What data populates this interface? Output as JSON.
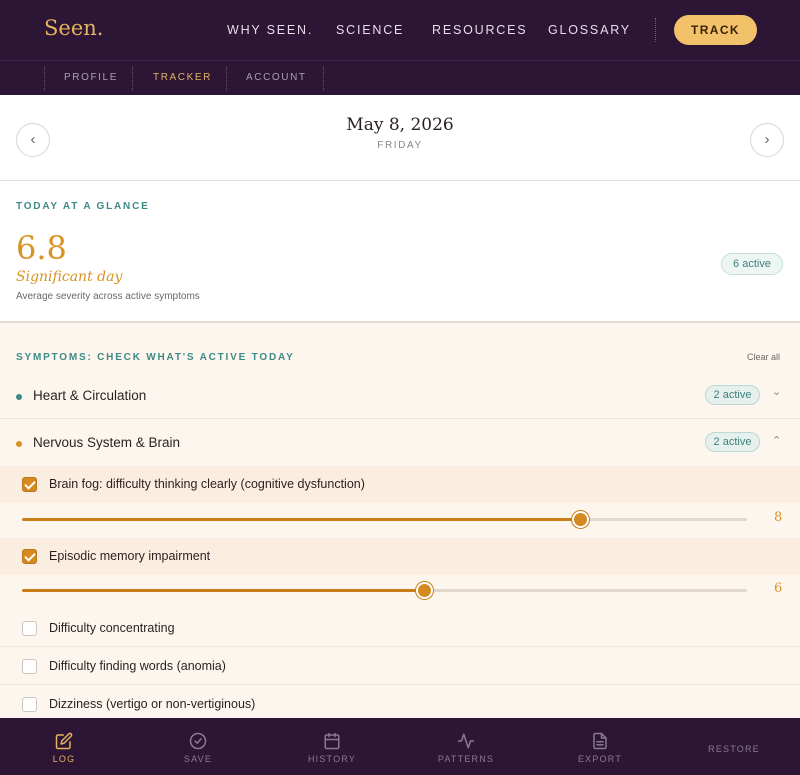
{
  "brand": {
    "logo": "Seen."
  },
  "nav": {
    "items": [
      {
        "label": "WHY SEEN."
      },
      {
        "label": "SCIENCE"
      },
      {
        "label": "RESOURCES"
      },
      {
        "label": "GLOSSARY"
      }
    ],
    "cta_label": "TRACK"
  },
  "subnav": {
    "items": [
      {
        "label": "PROFILE"
      },
      {
        "label": "TRACKER",
        "active": true
      },
      {
        "label": "ACCOUNT"
      }
    ]
  },
  "date": {
    "main": "May 8, 2026",
    "day": "FRIDAY",
    "prev_icon": "chevron-left-icon",
    "next_icon": "chevron-right-icon"
  },
  "glance": {
    "label": "TODAY AT A GLANCE",
    "score": "6.8",
    "score_word": "Significant day",
    "description": "Average severity across active symptoms",
    "active_count": "6 active"
  },
  "symptoms": {
    "label": "SYMPTOMS: CHECK WHAT'S ACTIVE TODAY",
    "clear_all": "Clear all",
    "categories": [
      {
        "name": "Heart & Circulation",
        "active": "2 active",
        "dot_color": "#3e8a86",
        "expanded": false
      },
      {
        "name": "Nervous System & Brain",
        "active": "2 active",
        "dot_color": "#d99324",
        "expanded": true
      }
    ],
    "items": [
      {
        "name": "Brain fog: difficulty thinking clearly (cognitive dysfunction)",
        "checked": true,
        "severity": "8",
        "severity_fraction": 0.77
      },
      {
        "name": "Episodic memory impairment",
        "checked": true,
        "severity": "6",
        "severity_fraction": 0.555
      },
      {
        "name": "Difficulty concentrating",
        "checked": false
      },
      {
        "name": "Difficulty finding words (anomia)",
        "checked": false
      },
      {
        "name": "Dizziness (vertigo or non-vertiginous)",
        "checked": false
      }
    ]
  },
  "bottom_tabs": [
    {
      "label": "LOG",
      "icon": "edit-icon",
      "active": true
    },
    {
      "label": "SAVE",
      "icon": "check-circle-icon"
    },
    {
      "label": "HISTORY",
      "icon": "calendar-icon"
    },
    {
      "label": "PATTERNS",
      "icon": "activity-icon"
    },
    {
      "label": "EXPORT",
      "icon": "document-icon"
    },
    {
      "label": "RESTORE"
    }
  ],
  "colors": {
    "accent": "#d99324",
    "brand_bg": "#2d1535",
    "teal": "#3e8a86"
  }
}
